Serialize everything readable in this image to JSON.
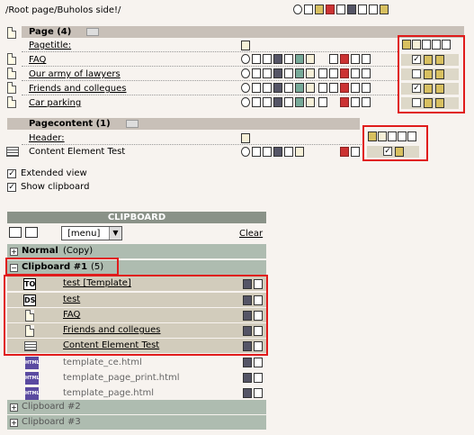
{
  "breadcrumb": "/Root page/Buholos side!/",
  "page_section": {
    "title": "Page (4)",
    "field_label": "Pagetitle:",
    "rows": [
      {
        "label": "FAQ"
      },
      {
        "label": "Our army of lawyers"
      },
      {
        "label": "Friends and collegues"
      },
      {
        "label": "Car parking"
      }
    ]
  },
  "content_section": {
    "title": "Pagecontent (1)",
    "field_label": "Header:",
    "rows": [
      {
        "label": "Content Element Test"
      }
    ]
  },
  "options": {
    "extended_view": "Extended view",
    "show_clipboard": "Show clipboard"
  },
  "clipboard": {
    "title": "CLIPBOARD",
    "menu_value": "[menu]",
    "clear_label": "Clear",
    "normal": "Normal",
    "normal_suffix": "(Copy)",
    "clip1": "Clipboard #1",
    "clip1_count": "(5)",
    "items": [
      {
        "icon": "TO",
        "label": "test [Template]"
      },
      {
        "icon": "DS",
        "label": "test"
      },
      {
        "icon": "page",
        "label": "FAQ"
      },
      {
        "icon": "page",
        "label": "Friends and collegues"
      },
      {
        "icon": "content",
        "label": "Content Element Test"
      }
    ],
    "templates": [
      {
        "label": "template_ce.html"
      },
      {
        "label": "template_page_print.html"
      },
      {
        "label": "template_page.html"
      }
    ],
    "html_icon_text": "HTML",
    "clip2": "Clipboard #2",
    "clip3": "Clipboard #3"
  },
  "colors": {
    "highlight": "#e01b1b",
    "header_bg": "#c8c0b8",
    "clip_header_bg": "#8a9288",
    "group_bg": "#aebcb0"
  }
}
